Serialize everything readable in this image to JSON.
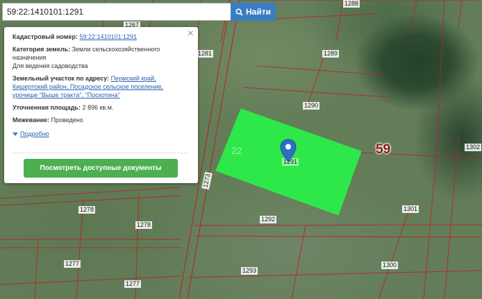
{
  "search": {
    "value": "59:22:1410101:1291",
    "button_label": "Найти",
    "icon": "search-icon"
  },
  "popup": {
    "cadastral_label": "Кадастровый номер:",
    "cadastral_value": "59:22:1410101:1291",
    "category_label": "Категория земель:",
    "category_value": "Земли сельскохозяйственного назначения",
    "usage_value": "Для ведения садоводства",
    "address_label": "Земельный участок по адресу:",
    "address_value": "Пермский край, Кишертокий район, Посадское сельское поселение, урочище \"Выше тракта\", \"Поскотина\"",
    "area_label": "Уточненная площадь:",
    "area_value": "2 896 кв.м.",
    "survey_label": "Межевание:",
    "survey_value": "Проведено",
    "details_link": "Подробно",
    "docs_button": "Посмотреть доступные документы",
    "close_icon": "close-icon"
  },
  "map": {
    "parcel_color": "#2ee84a",
    "boundary_color": "#b3262c",
    "region_label": "59",
    "district_label": "22",
    "parcel_labels": [
      "1288",
      "1267",
      "1281",
      "1289",
      "1290",
      "1302",
      "1273",
      "1278",
      "1278",
      "1292",
      "1301",
      "1277",
      "1293",
      "1300",
      "1277",
      "1291"
    ]
  }
}
